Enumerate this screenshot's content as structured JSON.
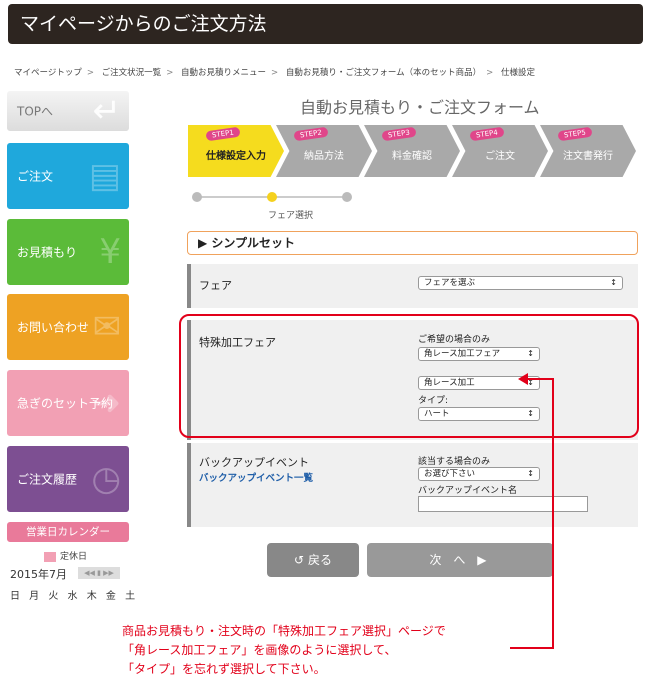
{
  "title": "マイページからのご注文方法",
  "breadcrumb": [
    "マイページトップ",
    "ご注文状況一覧",
    "自動お見積りメニュー",
    "自動お見積り・ご注文フォーム（本のセット商品）",
    "仕様設定"
  ],
  "breadcrumb_sep": ">",
  "sidebar": {
    "top": "TOPへ",
    "order": "ご注文",
    "quote": "お見積もり",
    "inquiry": "お問い合わせ",
    "rush": "急ぎのセット予約",
    "history": "ご注文履歴"
  },
  "calendar": {
    "title": "営業日カレンダー",
    "legend": "定休日",
    "month": "2015年7月",
    "nav": "◀◀ ▮ ▶▶",
    "days": "日 月 火 水 木 金 土"
  },
  "form_title": "自動お見積もり・ご注文フォーム",
  "steps": [
    {
      "tag": "STEP1",
      "label": "仕様設定入力"
    },
    {
      "tag": "STEP2",
      "label": "納品方法"
    },
    {
      "tag": "STEP3",
      "label": "料金確認"
    },
    {
      "tag": "STEP4",
      "label": "ご注文"
    },
    {
      "tag": "STEP5",
      "label": "注文書発行"
    }
  ],
  "progress_label": "フェア選択",
  "set_header": "▶ シンプルセット",
  "row_fair": {
    "label": "フェア",
    "select": "フェアを選ぶ"
  },
  "row_special": {
    "label": "特殊加工フェア",
    "note": "ご希望の場合のみ",
    "select1": "角レース加工フェア",
    "select2": "角レース加工",
    "type_label": "タイプ:",
    "select3": "ハート"
  },
  "row_backup": {
    "label": "バックアップイベント",
    "link": "バックアップイベント一覧",
    "note": "該当する場合のみ",
    "select": "お選び下さい",
    "name_label": "バックアップイベント名"
  },
  "buttons": {
    "back": "戻る",
    "next": "次 へ"
  },
  "icons": {
    "arrow": "↕",
    "back": "↺",
    "next": "▶"
  },
  "note_lines": [
    "商品お見積もり・注文時の「特殊加工フェア選択」ページで",
    "「角レース加工フェア」を画像のように選択して、",
    "「タイプ」を忘れず選択して下さい。"
  ],
  "colors": {
    "accent": "#e2001a",
    "step_active": "#f5dc1e",
    "link": "#1f5ea8"
  }
}
